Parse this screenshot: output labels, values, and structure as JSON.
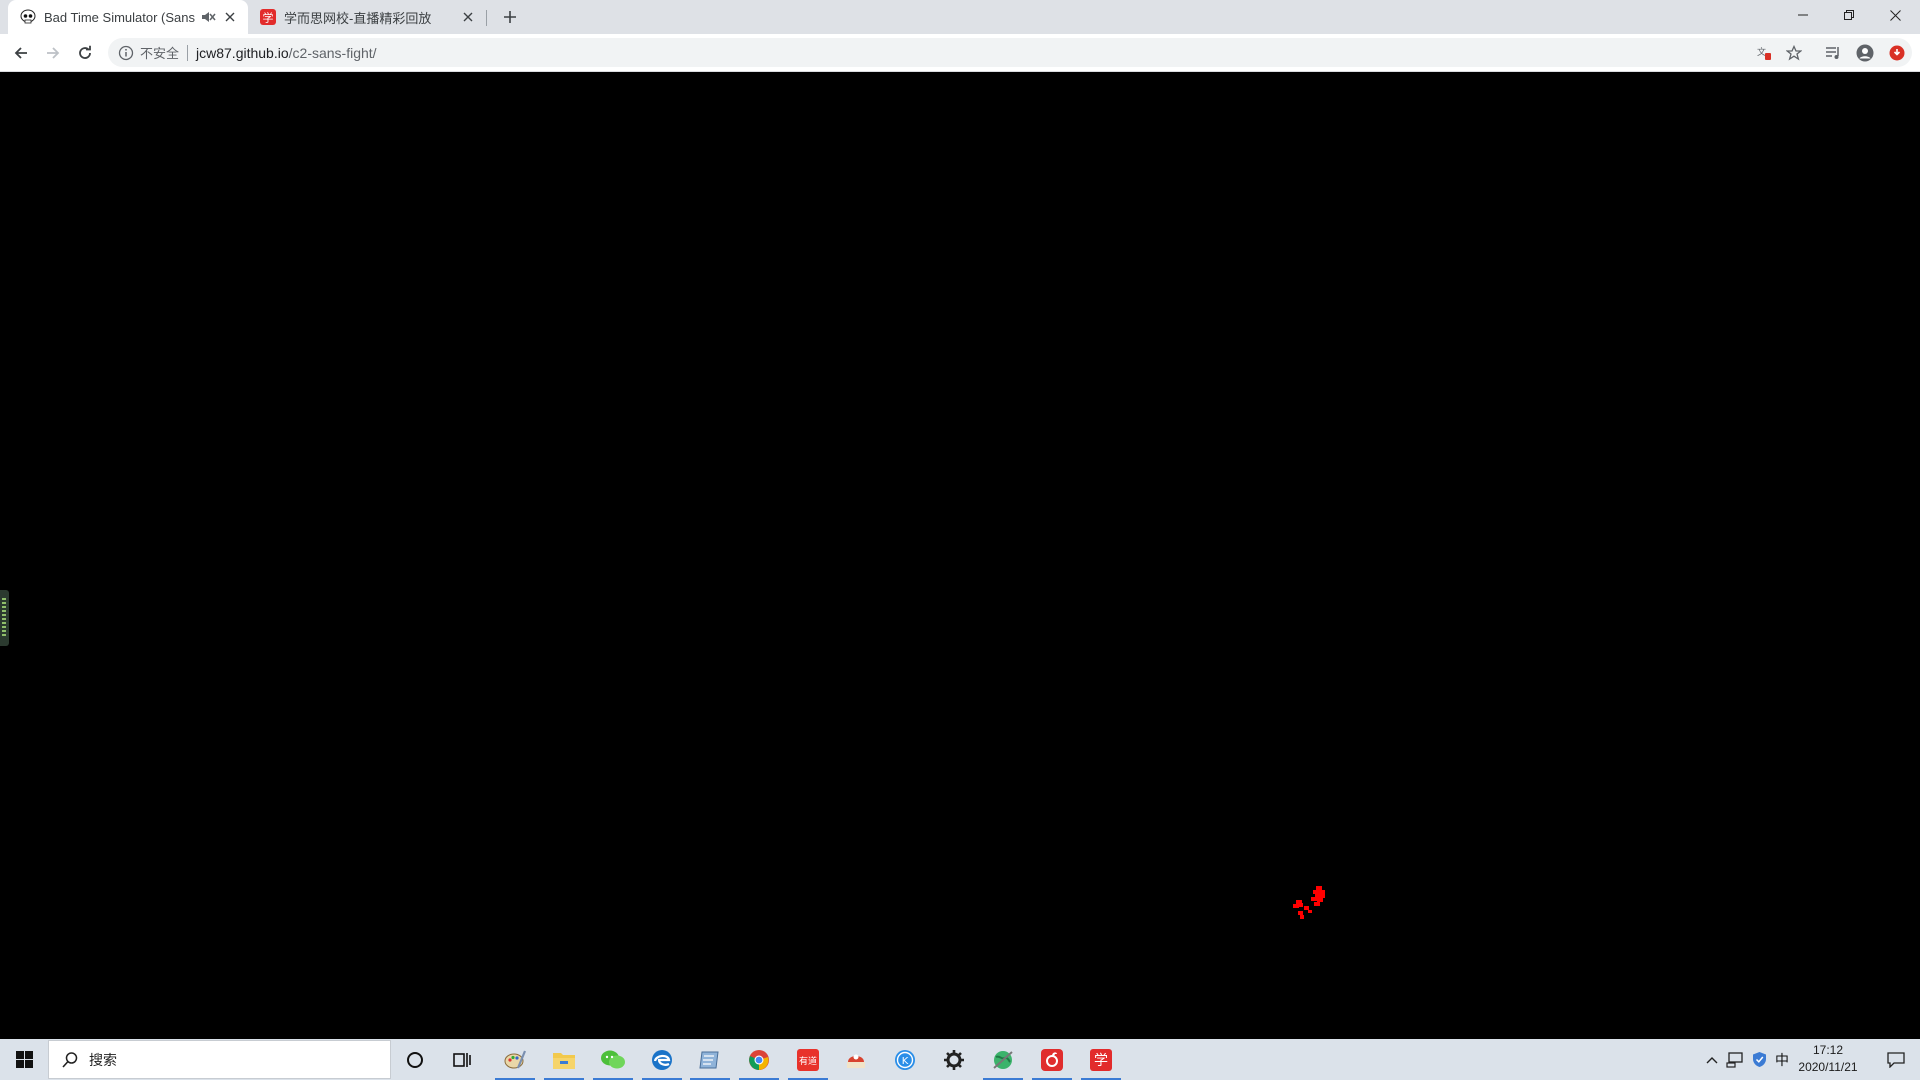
{
  "browser": {
    "tabs": [
      {
        "title": "Bad Time Simulator (Sans",
        "icon": "skull-icon",
        "active": true,
        "muted": true
      },
      {
        "title": "学而思网校-直播精彩回放",
        "icon": "xue-app-icon",
        "active": false
      }
    ],
    "address": {
      "security_label": "不安全",
      "host": "jcw87.github.io",
      "path": "/c2-sans-fight/"
    }
  },
  "taskbar": {
    "search_placeholder": "搜索",
    "pinned": [
      {
        "name": "cortana-icon"
      },
      {
        "name": "task-view-icon"
      },
      {
        "name": "paint-icon",
        "running": true
      },
      {
        "name": "file-explorer-icon",
        "running": true
      },
      {
        "name": "wechat-icon",
        "running": true
      },
      {
        "name": "edge-icon",
        "running": true
      },
      {
        "name": "notepad-icon",
        "running": true
      },
      {
        "name": "chrome-icon",
        "running": true
      },
      {
        "name": "youdao-dictionary-icon",
        "running": true
      },
      {
        "name": "game-app-icon",
        "running": false
      },
      {
        "name": "kugou-music-icon",
        "running": false
      },
      {
        "name": "settings-gear-icon",
        "running": false
      },
      {
        "name": "globe-app-icon",
        "running": true
      },
      {
        "name": "netease-music-icon",
        "running": true
      },
      {
        "name": "xue-app-icon",
        "running": true
      }
    ],
    "tray": {
      "ime": "中",
      "time": "17:12",
      "date": "2020/11/21"
    }
  },
  "colors": {
    "game_background": "#000000",
    "soul_red": "#ff0000",
    "taskbar_accent": "#3b7bd4"
  }
}
